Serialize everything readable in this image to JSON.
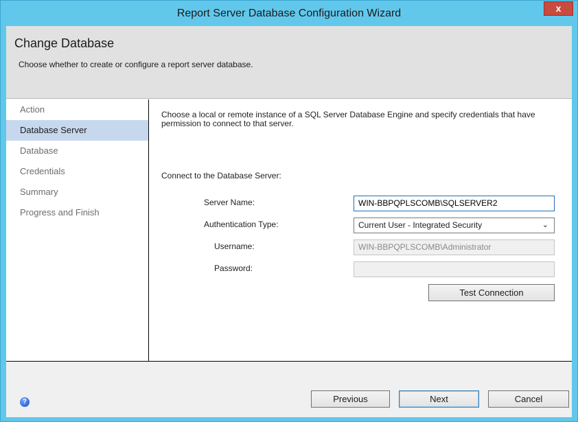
{
  "window": {
    "title": "Report Server Database Configuration Wizard",
    "close_glyph": "x"
  },
  "header": {
    "title": "Change Database",
    "subtitle": "Choose whether to create or configure a report server database."
  },
  "nav": {
    "items": [
      {
        "label": "Action",
        "active": false
      },
      {
        "label": "Database Server",
        "active": true
      },
      {
        "label": "Database",
        "active": false
      },
      {
        "label": "Credentials",
        "active": false
      },
      {
        "label": "Summary",
        "active": false
      },
      {
        "label": "Progress and Finish",
        "active": false
      }
    ]
  },
  "content": {
    "description": "Choose a local or remote instance of a SQL Server Database Engine and specify credentials that have permission to connect to that server.",
    "section_label": "Connect to the Database Server:",
    "server_name": {
      "label": "Server Name:",
      "value": "WIN-BBPQPLSCOMB\\SQLSERVER2"
    },
    "auth_type": {
      "label": "Authentication Type:",
      "value": "Current User - Integrated Security"
    },
    "username": {
      "label": "Username:",
      "value": "WIN-BBPQPLSCOMB\\Administrator"
    },
    "password": {
      "label": "Password:",
      "value": ""
    },
    "test_connection_label": "Test Connection"
  },
  "footer": {
    "previous_label": "Previous",
    "next_label": "Next",
    "cancel_label": "Cancel",
    "help_glyph": "?"
  },
  "colors": {
    "title_bar": "#61c8ec",
    "close_button": "#c74b3f",
    "header_bg": "#e1e1e1",
    "nav_selected": "#c7d8ee",
    "footer_bg": "#f0f0f0"
  }
}
